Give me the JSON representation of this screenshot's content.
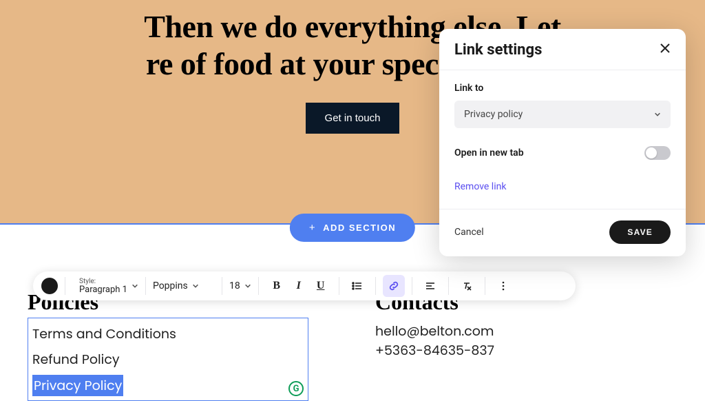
{
  "hero": {
    "line1": "Then we do everything else. Let",
    "line2": "re of food at your special event:",
    "cta": "Get in touch"
  },
  "add_section": "ADD SECTION",
  "toolbar": {
    "style_label": "Style:",
    "style_value": "Paragraph 1",
    "font": "Poppins",
    "size": "18",
    "color": "#1a1a1a"
  },
  "footer": {
    "policies_heading": "Policies",
    "policies": [
      "Terms and Conditions",
      "Refund Policy",
      "Privacy Policy"
    ],
    "contacts_heading": "Contacts",
    "email": "hello@belton.com",
    "phone": "+5363-84635-837"
  },
  "modal": {
    "title": "Link settings",
    "link_to_label": "Link to",
    "link_to_value": "Privacy policy",
    "open_new_tab": "Open in new tab",
    "open_new_tab_on": false,
    "remove": "Remove link",
    "cancel": "Cancel",
    "save": "SAVE"
  }
}
